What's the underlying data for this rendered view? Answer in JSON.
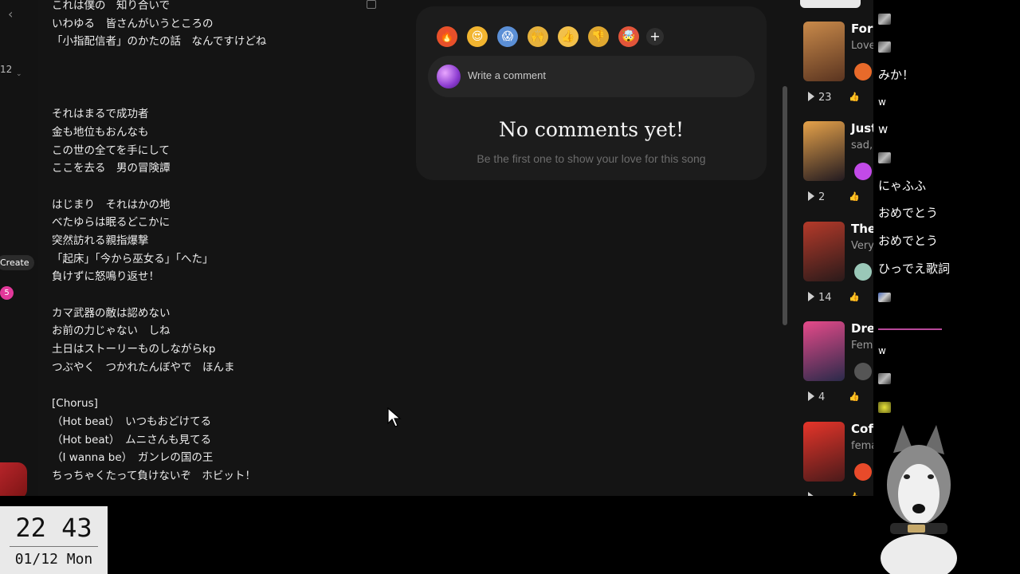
{
  "sidebar": {
    "back_label": "‹",
    "counter_text": "12",
    "create_label": "Create",
    "notification_count": "5"
  },
  "lyrics": [
    "これは僕の　知り合いで",
    "いわゆる　皆さんがいうところの",
    "「小指配信者」のかたの話　なんですけどね",
    "",
    "",
    "",
    "それはまるで成功者",
    "金も地位もおんなも",
    "この世の全てを手にして",
    "ここを去る　男の冒険譚",
    "",
    "はじまり　それはかの地",
    "べたゆらは眠るどこかに",
    "突然訪れる親指爆撃",
    "「起床」「今から巫女る」「へた」",
    "負けずに怒鳴り返せ！",
    "",
    "カマ武器の敵は認めない",
    "お前の力じゃない　しね",
    "土日はストーリーものしながらkp",
    "つぶやく　つかれたんぼやで　ほんま",
    "",
    "[Chorus]",
    "（Hot beat）　いつもおどけてる",
    "（Hot beat）　ムニさんも見てる",
    "（I wanna be）　ガンレの国の王",
    "ちっちゃくたって負けないぞ　ホビット！"
  ],
  "comments": {
    "reactions": [
      {
        "name": "fire-icon",
        "glyph": "🔥",
        "color": "#e8502a"
      },
      {
        "name": "heart-eyes-icon",
        "glyph": "😍",
        "color": "#f2b530"
      },
      {
        "name": "screaming-face-icon",
        "glyph": "😱",
        "color": "#5b8fd6"
      },
      {
        "name": "raising-hands-icon",
        "glyph": "🙌",
        "color": "#e7b23c"
      },
      {
        "name": "thumbs-up-icon",
        "glyph": "👍",
        "color": "#f2c04a"
      },
      {
        "name": "thumbs-down-icon",
        "glyph": "👎",
        "color": "#e0a830"
      },
      {
        "name": "mind-blown-icon",
        "glyph": "🤯",
        "color": "#e2553a"
      }
    ],
    "add_reaction_label": "+",
    "placeholder": "Write a comment",
    "empty_title": "No comments yet!",
    "empty_subtitle": "Be the first one to show your love for this song"
  },
  "songs": [
    {
      "title": "Fore",
      "subtitle": "Love",
      "plays": "23",
      "thumb": [
        "#c98a4a",
        "#5a3420"
      ],
      "avatar": "#e86a2a"
    },
    {
      "title": "Just",
      "subtitle": "sad,",
      "plays": "2",
      "thumb": [
        "#e6a24a",
        "#221a20"
      ],
      "avatar": "#c24ae8"
    },
    {
      "title": "The",
      "subtitle": "Very",
      "plays": "14",
      "thumb": [
        "#b53a2a",
        "#2a1a1a"
      ],
      "avatar": "#9ac8b8"
    },
    {
      "title": "Drea",
      "subtitle": "Fem",
      "plays": "4",
      "thumb": [
        "#e64a8a",
        "#2a2a4a"
      ],
      "avatar": "#555555"
    },
    {
      "title": "Coff",
      "subtitle": "fema",
      "plays": "",
      "thumb": [
        "#e6352a",
        "#4a1a1a"
      ],
      "avatar": "#e84a2a"
    }
  ],
  "chat": {
    "messages": [
      "みか！",
      "w",
      "w",
      "にゃふふ",
      "おめでとう",
      "おめでとう",
      "ひっでえ歌詞",
      "w"
    ]
  },
  "clock": {
    "time": "22 43",
    "date": "01/12 Mon"
  }
}
